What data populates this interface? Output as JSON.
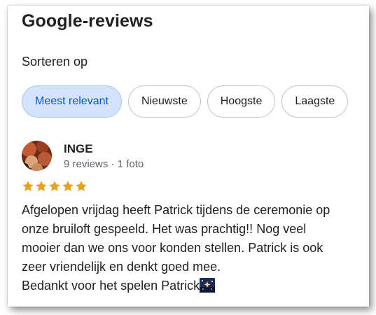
{
  "header": {
    "title": "Google-reviews"
  },
  "sort": {
    "label": "Sorteren op",
    "options": [
      {
        "label": "Meest relevant",
        "selected": true
      },
      {
        "label": "Nieuwste",
        "selected": false
      },
      {
        "label": "Hoogste",
        "selected": false
      },
      {
        "label": "Laagste",
        "selected": false
      }
    ]
  },
  "review": {
    "author": "INGE",
    "meta": "9 reviews · 1 foto",
    "rating": 5,
    "lines": [
      "Afgelopen vrijdag heeft Patrick tijdens de ceremonie op",
      "onze bruiloft gespeeld. Het was prachtig!! Nog veel",
      "mooier dan we ons voor konden stellen. Patrick is ook",
      "zeer vriendelijk en denkt goed mee.",
      "Bedankt voor het spelen Patrick"
    ],
    "emoji_icon": "night-sky-sparkle-icon"
  },
  "colors": {
    "accent_chip_bg": "#d3e3fd",
    "accent_chip_text": "#0b57d0",
    "star": "#e8a317"
  }
}
